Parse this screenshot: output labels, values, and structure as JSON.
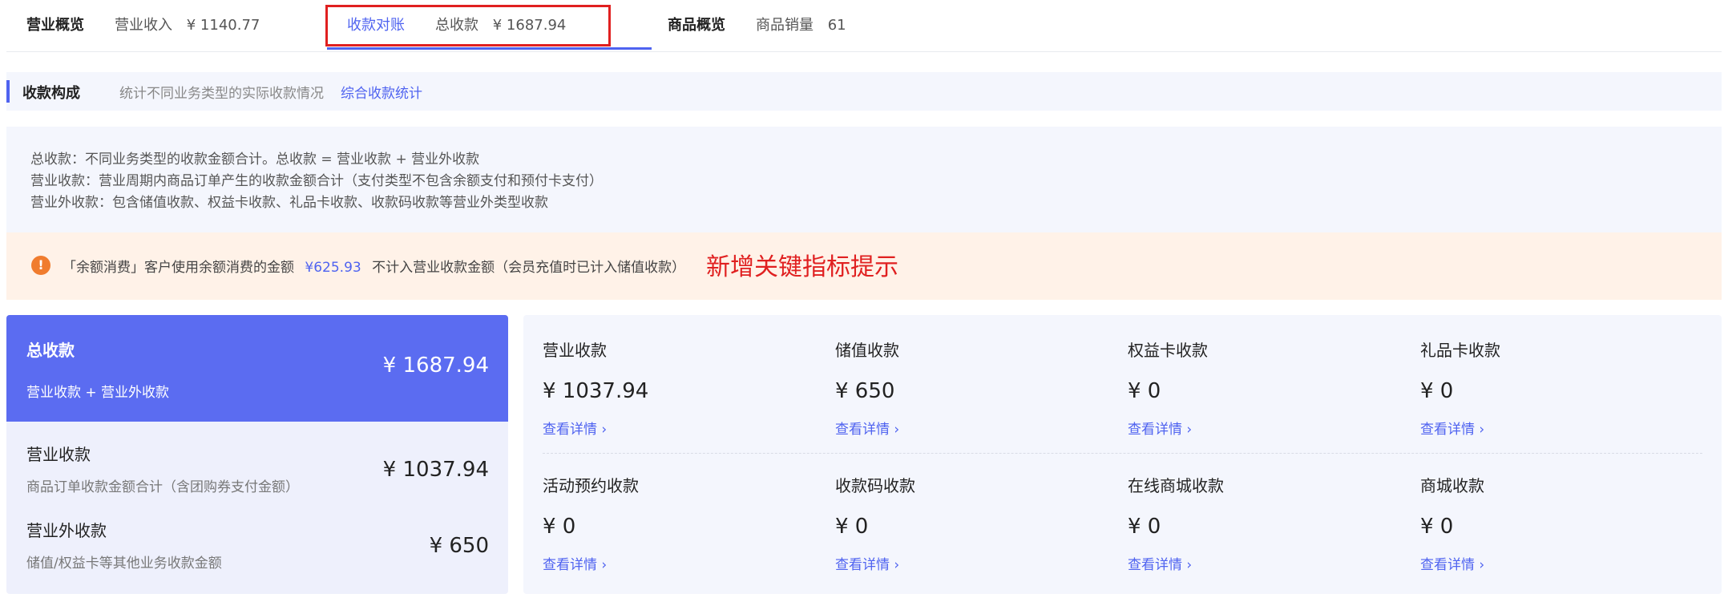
{
  "tabs": [
    {
      "title": "营业概览",
      "metric_label": "营业收入",
      "metric_value": "¥ 1140.77"
    },
    {
      "title": "收款对账",
      "metric_label": "总收款",
      "metric_value": "¥ 1687.94"
    },
    {
      "title": "商品概览",
      "metric_label": "商品销量",
      "metric_value": "61"
    }
  ],
  "section": {
    "title": "收款构成",
    "description": "统计不同业务类型的实际收款情况",
    "link": "综合收款统计"
  },
  "notes": [
    "总收款：不同业务类型的收款金额合计。总收款 = 营业收款 + 营业外收款",
    "营业收款：营业周期内商品订单产生的收款金额合计（支付类型不包含余额支付和预付卡支付）",
    "营业外收款：包含储值收款、权益卡收款、礼品卡收款、收款码收款等营业外类型收款"
  ],
  "alert": {
    "icon": "!",
    "prefix": "「余额消费」客户使用余额消费的金额",
    "amount": "¥625.93",
    "suffix": "不计入营业收款金额（会员充值时已计入储值收款）",
    "annotation": "新增关键指标提示"
  },
  "summary": {
    "total": {
      "title": "总收款",
      "subtitle": "营业收款 + 营业外收款",
      "value": "¥ 1687.94"
    },
    "operating": {
      "title": "营业收款",
      "description": "商品订单收款金额合计（含团购券支付金额）",
      "value": "¥ 1037.94"
    },
    "non_operating": {
      "title": "营业外收款",
      "description": "储值/权益卡等其他业务收款金额",
      "value": "¥ 650"
    }
  },
  "metrics": [
    {
      "title": "营业收款",
      "value": "¥ 1037.94",
      "link": "查看详情 ›"
    },
    {
      "title": "储值收款",
      "value": "¥ 650",
      "link": "查看详情 ›"
    },
    {
      "title": "权益卡收款",
      "value": "¥ 0",
      "link": "查看详情 ›"
    },
    {
      "title": "礼品卡收款",
      "value": "¥ 0",
      "link": "查看详情 ›"
    },
    {
      "title": "活动预约收款",
      "value": "¥ 0",
      "link": "查看详情 ›"
    },
    {
      "title": "收款码收款",
      "value": "¥ 0",
      "link": "查看详情 ›"
    },
    {
      "title": "在线商城收款",
      "value": "¥ 0",
      "link": "查看详情 ›"
    },
    {
      "title": "商城收款",
      "value": "¥ 0",
      "link": "查看详情 ›"
    }
  ],
  "colors": {
    "accent": "#4f63f0",
    "total_card": "#5b6cf1",
    "highlight_box": "#e02020",
    "alert_icon": "#f07c2e"
  }
}
